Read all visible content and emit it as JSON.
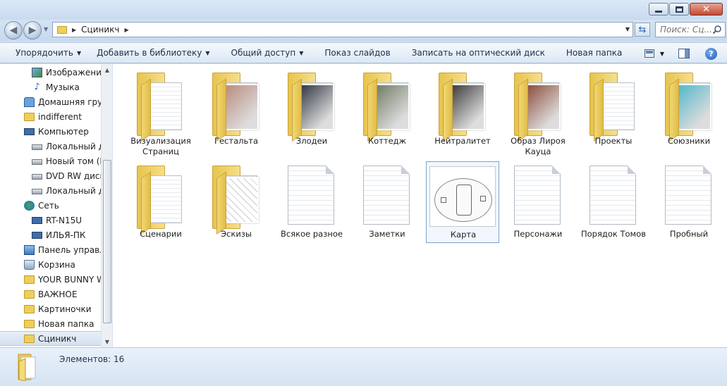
{
  "address": {
    "crumb": "Сциникч",
    "search_placeholder": "Поиск: Сц..."
  },
  "toolbar": {
    "items": [
      {
        "label": "Упорядочить",
        "has_arrow": true
      },
      {
        "label": "Добавить в библиотеку",
        "has_arrow": true
      },
      {
        "label": "Общий доступ",
        "has_arrow": true
      },
      {
        "label": "Показ слайдов",
        "has_arrow": false
      },
      {
        "label": "Записать на оптический диск",
        "has_arrow": false
      },
      {
        "label": "Новая папка",
        "has_arrow": false
      }
    ]
  },
  "sidebar": {
    "items": [
      {
        "label": "Изображения",
        "icon": "pictures-icon",
        "indent": 2
      },
      {
        "label": "Музыка",
        "icon": "music-icon",
        "indent": 2
      },
      {
        "label": "Домашняя груп",
        "icon": "homegroup-icon",
        "indent": 1
      },
      {
        "label": "indifferent",
        "icon": "folder-icon",
        "indent": 1
      },
      {
        "label": "Компьютер",
        "icon": "computer-icon",
        "indent": 1
      },
      {
        "label": "Локальный ди",
        "icon": "drive-icon",
        "indent": 2
      },
      {
        "label": "Новый том (D",
        "icon": "drive-icon",
        "indent": 2
      },
      {
        "label": "DVD RW диско",
        "icon": "drive-icon",
        "indent": 2
      },
      {
        "label": "Локальный ди",
        "icon": "drive-icon",
        "indent": 2
      },
      {
        "label": "Сеть",
        "icon": "network-icon",
        "indent": 1
      },
      {
        "label": "RT-N15U",
        "icon": "computer-icon",
        "indent": 2
      },
      {
        "label": "ИЛЬЯ-ПК",
        "icon": "computer-icon",
        "indent": 2
      },
      {
        "label": "Панель управле",
        "icon": "control-panel-icon",
        "indent": 1
      },
      {
        "label": "Корзина",
        "icon": "recycle-bin-icon",
        "indent": 1
      },
      {
        "label": "YOUR BUNNY W",
        "icon": "folder-icon",
        "indent": 1
      },
      {
        "label": "ВАЖНОЕ",
        "icon": "folder-icon",
        "indent": 1
      },
      {
        "label": "Картиночки",
        "icon": "folder-icon",
        "indent": 1
      },
      {
        "label": "Новая папка",
        "icon": "folder-icon",
        "indent": 1
      },
      {
        "label": "Сциникч",
        "icon": "folder-icon",
        "indent": 1,
        "selected": true
      }
    ]
  },
  "files": [
    {
      "label": "Визуализация Страниц",
      "kind": "folder",
      "preview": "paper"
    },
    {
      "label": "Гестальта",
      "kind": "folder",
      "preview": "photo",
      "tone": "#b98b7c"
    },
    {
      "label": "Злодеи",
      "kind": "folder",
      "preview": "photo",
      "tone": "#2e3440"
    },
    {
      "label": "Коттедж",
      "kind": "folder",
      "preview": "photo",
      "tone": "#6f7b63"
    },
    {
      "label": "Нейтралитет",
      "kind": "folder",
      "preview": "photo",
      "tone": "#3a3a3a"
    },
    {
      "label": "Образ Лироя Кауца",
      "kind": "folder",
      "preview": "photo",
      "tone": "#8b4c3a"
    },
    {
      "label": "Проекты",
      "kind": "folder",
      "preview": "paper"
    },
    {
      "label": "Союзники",
      "kind": "folder",
      "preview": "photo",
      "tone": "#4fb7c9"
    },
    {
      "label": "Сценарии",
      "kind": "folder",
      "preview": "paper"
    },
    {
      "label": "Эскизы",
      "kind": "folder",
      "preview": "sketch"
    },
    {
      "label": "Всякое разное",
      "kind": "document"
    },
    {
      "label": "Заметки",
      "kind": "document"
    },
    {
      "label": "Карта",
      "kind": "image",
      "selected": true
    },
    {
      "label": "Персонажи",
      "kind": "document"
    },
    {
      "label": "Порядок Томов",
      "kind": "document"
    },
    {
      "label": "Пробный",
      "kind": "document"
    }
  ],
  "status": {
    "count_text": "Элементов: 16"
  }
}
